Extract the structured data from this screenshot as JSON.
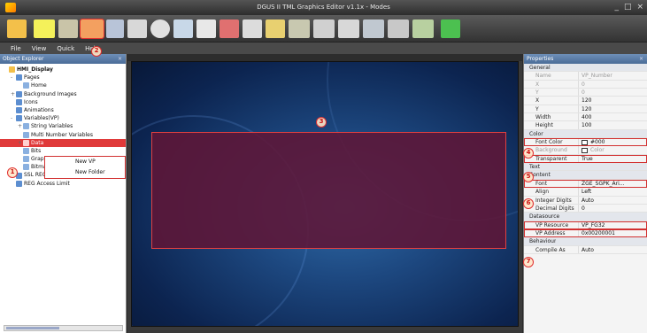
{
  "window": {
    "title": "DGUS II TML Graphics Editor v1.1x - Modes",
    "controls": [
      "_",
      "□",
      "×"
    ]
  },
  "menu": [
    "File",
    "View",
    "Quick",
    "Help"
  ],
  "left_panel": {
    "title": "Object Explorer",
    "tree": [
      {
        "label": "HMI_Display",
        "level": 0,
        "bold": true
      },
      {
        "label": "Pages",
        "level": 1,
        "expand": "-"
      },
      {
        "label": "Home",
        "level": 2
      },
      {
        "label": "Background Images",
        "level": 1,
        "expand": "+"
      },
      {
        "label": "Icons",
        "level": 1
      },
      {
        "label": "Animations",
        "level": 1
      },
      {
        "label": "Variables(VP)",
        "level": 1,
        "expand": "-"
      },
      {
        "label": "String Variables",
        "level": 2,
        "expand": "+"
      },
      {
        "label": "Multi Number Variables",
        "level": 2
      },
      {
        "label": "Data",
        "level": 2,
        "selected": true,
        "expand": "+"
      },
      {
        "label": "Bits",
        "level": 2
      },
      {
        "label": "Graph",
        "level": 2
      },
      {
        "label": "Bitmap Variables",
        "level": 2
      },
      {
        "label": "SSL REG",
        "level": 1
      },
      {
        "label": "REG Access Limit",
        "level": 1
      }
    ],
    "context_menu": [
      "New VP",
      "New Folder"
    ]
  },
  "properties": {
    "title": "Properties",
    "rows": [
      {
        "section": "General"
      },
      {
        "k": "Name",
        "v": "VP_Number",
        "dim": true
      },
      {
        "k": "X",
        "v": "0",
        "dim": true
      },
      {
        "k": "Y",
        "v": "0",
        "dim": true
      },
      {
        "k": "X",
        "v": "120"
      },
      {
        "k": "Y",
        "v": "120"
      },
      {
        "k": "Width",
        "v": "400"
      },
      {
        "k": "Height",
        "v": "100"
      },
      {
        "section": "Color"
      },
      {
        "k": "Font Color",
        "v": "#000",
        "swatch": true,
        "hl": true
      },
      {
        "k": "Background",
        "v": "Color",
        "dim": true,
        "swatch": true
      },
      {
        "k": "Transparent",
        "v": "True",
        "hl": true
      },
      {
        "section": "Text"
      },
      {
        "section": "Content"
      },
      {
        "k": "Font",
        "v": "ZGE_SGPK_Ari...",
        "hl": true
      },
      {
        "k": "Align",
        "v": "Left"
      },
      {
        "k": "Integer Digits",
        "v": "Auto"
      },
      {
        "k": "Decimal Digits",
        "v": "0"
      },
      {
        "section": "Datasource"
      },
      {
        "k": "VP Resource",
        "v": "VP_FG32",
        "hl": true
      },
      {
        "k": "VP Address",
        "v": "0x00200001",
        "hl": true
      },
      {
        "section": "Behaviour"
      },
      {
        "k": "Compile As",
        "v": "Auto"
      }
    ]
  },
  "badges": {
    "b1": "1",
    "b2": "2",
    "b3": "3",
    "b4": "4",
    "b5": "5",
    "b6": "6",
    "b7": "7"
  },
  "colors": {
    "highlight": "#d23030",
    "canvas": "#1d4880",
    "widget": "#5f1637"
  }
}
